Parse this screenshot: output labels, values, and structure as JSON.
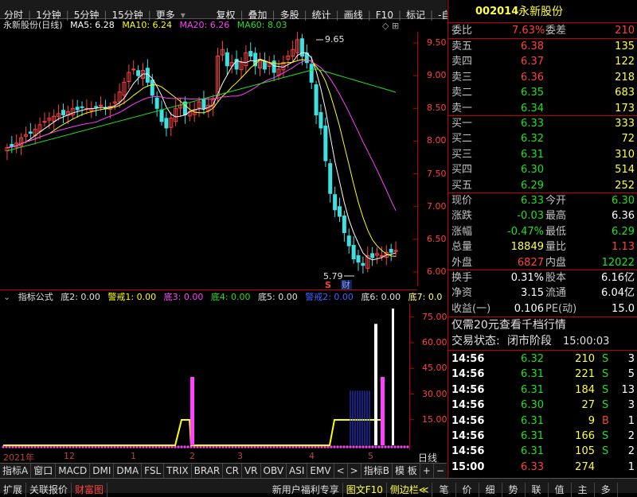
{
  "topbar": {
    "items": [
      "分时",
      "1分钟",
      "5分钟",
      "15分钟",
      "更多",
      "复权",
      "叠加",
      "多股",
      "统计",
      "画线",
      "F10",
      "标记",
      "-自选",
      "返回"
    ]
  },
  "main_chart": {
    "stock_label": "永新股份(日线)",
    "ma5": "MA5: 6.28",
    "ma10": "MA10: 6.24",
    "ma20": "MA20: 6.26",
    "ma60": "MA60: 8.03",
    "high_label": "9.65",
    "low_label": "5.79",
    "marker_s": "S",
    "marker_cai": "财",
    "yaxis": [
      "9.50",
      "9.00",
      "8.50",
      "8.00",
      "7.50",
      "7.00",
      "6.50",
      "6.00"
    ],
    "colors": {
      "ma5": "#ffffff",
      "ma10": "#ffff00",
      "ma20": "#ff40ff",
      "ma60": "#20e020",
      "up": "#ff4040",
      "down": "#40e0e0"
    }
  },
  "indicator": {
    "label": "指标公式",
    "d2": "底2: 0.00",
    "jj1": "警戒1: 0.00",
    "d3": "底3: 0.00",
    "d4": "底4: 0.00",
    "d5": "底5: 0.00",
    "jj2": "警戒2: 0.00",
    "d6": "底6: 0.00",
    "d7": "底7: 0.0",
    "yaxis": [
      "75.00",
      "60.00",
      "45.00",
      "30.00",
      "15.00"
    ]
  },
  "datebar": {
    "labels": [
      "2021年",
      "12",
      "1",
      "2",
      "3",
      "4",
      "5"
    ],
    "right": "日线"
  },
  "tabbar": {
    "items": [
      "指标A",
      "窗口",
      "MACD",
      "DMI",
      "DMA",
      "FSL",
      "TRIX",
      "BRAR",
      "CR",
      "VR",
      "OBV",
      "ASI",
      "EMV",
      "<",
      ">",
      "指标B",
      "模 板",
      "+",
      "−"
    ]
  },
  "bottombar": {
    "items": [
      "扩展",
      "关联报价",
      "财富图"
    ],
    "right": [
      "新用户福利专享",
      "图文F10",
      "侧边栏≪",
      "笔",
      "价",
      "细",
      "势",
      "联",
      "值",
      "主",
      "多"
    ]
  },
  "quote": {
    "code": "002014",
    "name": "永新股份",
    "weibi_label": "委比",
    "weibi": "7.63%",
    "weicha_label": "委差",
    "weicha": "210",
    "asks": [
      {
        "label": "卖五",
        "price": "6.38",
        "vol": "135"
      },
      {
        "label": "卖四",
        "price": "6.37",
        "vol": "122"
      },
      {
        "label": "卖三",
        "price": "6.36",
        "vol": "218"
      },
      {
        "label": "卖二",
        "price": "6.35",
        "vol": "683"
      },
      {
        "label": "卖一",
        "price": "6.34",
        "vol": "173"
      }
    ],
    "bids": [
      {
        "label": "买一",
        "price": "6.33",
        "vol": "333"
      },
      {
        "label": "买二",
        "price": "6.32",
        "vol": "72"
      },
      {
        "label": "买三",
        "price": "6.31",
        "vol": "310"
      },
      {
        "label": "买四",
        "price": "6.30",
        "vol": "514"
      },
      {
        "label": "买五",
        "price": "6.29",
        "vol": "252"
      }
    ],
    "stats": [
      {
        "l1": "现价",
        "v1": "6.33",
        "l2": "今开",
        "v2": "6.30"
      },
      {
        "l1": "涨跌",
        "v1": "-0.03",
        "l2": "最高",
        "v2": "6.36"
      },
      {
        "l1": "涨幅",
        "v1": "-0.47%",
        "l2": "最低",
        "v2": "6.29"
      },
      {
        "l1": "总量",
        "v1": "18849",
        "l2": "量比",
        "v2": "1.13"
      },
      {
        "l1": "外盘",
        "v1": "6827",
        "l2": "内盘",
        "v2": "12022"
      }
    ],
    "stats2": [
      {
        "l1": "换手",
        "v1": "0.31%",
        "l2": "股本",
        "v2": "6.16亿"
      },
      {
        "l1": "净资",
        "v1": "3.15",
        "l2": "流通",
        "v2": "6.04亿"
      },
      {
        "l1": "收益(一)",
        "v1": "0.106",
        "l2": "PE(动)",
        "v2": "15.0"
      }
    ],
    "promo": "仅需20元查看千档行情",
    "status_label": "交易状态:",
    "status": "闭市阶段",
    "status_time": "15:00:03",
    "ticks": [
      {
        "t": "14:56",
        "p": "6.32",
        "v": "210",
        "s": "S",
        "n": "3"
      },
      {
        "t": "14:56",
        "p": "6.31",
        "v": "221",
        "s": "S",
        "n": "5"
      },
      {
        "t": "14:56",
        "p": "6.31",
        "v": "184",
        "s": "S",
        "n": "13"
      },
      {
        "t": "14:56",
        "p": "6.30",
        "v": "27",
        "s": "S",
        "n": "3"
      },
      {
        "t": "14:56",
        "p": "6.31",
        "v": "9",
        "s": "B",
        "n": "1"
      },
      {
        "t": "14:56",
        "p": "6.31",
        "v": "166",
        "s": "S",
        "n": "2"
      },
      {
        "t": "14:56",
        "p": "6.31",
        "v": "105",
        "s": "S",
        "n": "2"
      },
      {
        "t": "15:00",
        "p": "6.33",
        "v": "274",
        "s": "",
        "n": "1"
      }
    ]
  }
}
